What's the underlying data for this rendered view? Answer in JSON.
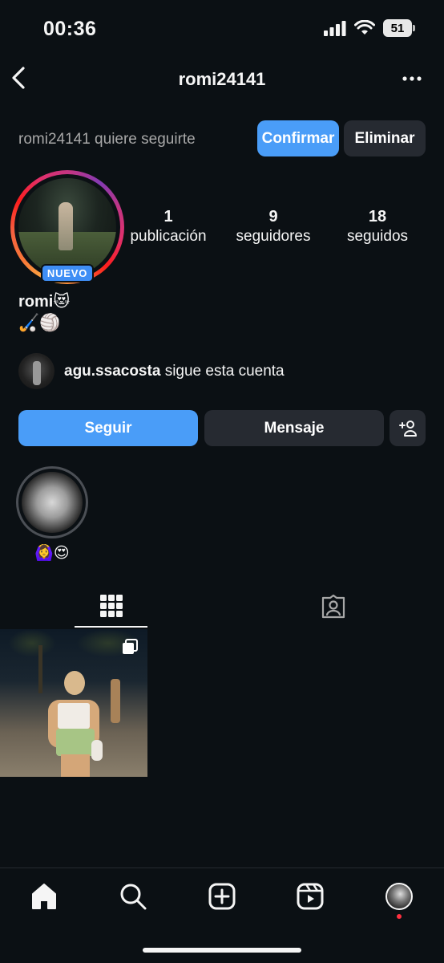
{
  "status_bar": {
    "time": "00:36",
    "battery": "51",
    "icons": [
      "signal-icon",
      "wifi-icon",
      "battery-icon"
    ]
  },
  "header": {
    "title": "romi24141",
    "icons": [
      "chevron-left-icon",
      "more-horizontal-icon"
    ]
  },
  "follow_request": {
    "text": "romi24141 quiere seguirte",
    "confirm_label": "Confirmar",
    "delete_label": "Eliminar"
  },
  "profile": {
    "badge": "NUEVO",
    "name": "romi😻",
    "bio": "🏑🏐",
    "stats": [
      {
        "value": "1",
        "label": "publicación"
      },
      {
        "value": "9",
        "label": "seguidores"
      },
      {
        "value": "18",
        "label": "seguidos"
      }
    ]
  },
  "followed_by": {
    "username": "agu.ssacosta",
    "text": "sigue esta cuenta"
  },
  "actions": {
    "follow_label": "Seguir",
    "message_label": "Mensaje",
    "suggest_icon": "add-person-icon"
  },
  "highlights": [
    {
      "label": "🙆‍♀️😍"
    }
  ],
  "tabs": [
    {
      "icon": "grid-icon",
      "active": true
    },
    {
      "icon": "tagged-icon",
      "active": false
    }
  ],
  "posts": [
    {
      "type": "carousel",
      "icon": "carousel-icon"
    }
  ],
  "bottom_nav": {
    "items": [
      "home-icon",
      "search-icon",
      "create-icon",
      "reels-icon",
      "profile-avatar"
    ],
    "active": "home-icon",
    "notification_dot_color": "#ff3040"
  },
  "colors": {
    "background": "#0b1014",
    "primary_button": "#4a9df8",
    "secondary_button": "#262a31",
    "muted_text": "#a8a8a8"
  }
}
